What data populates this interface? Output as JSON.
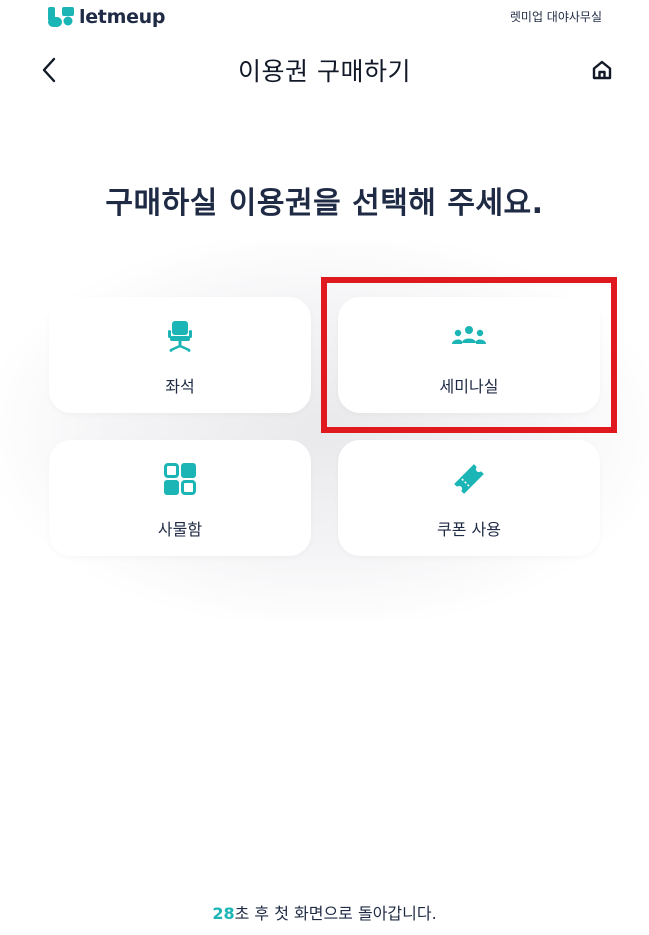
{
  "topbar": {
    "brand": "letmeup",
    "store_name": "렛미업 대야사무실"
  },
  "header": {
    "title": "이용권 구매하기",
    "back_icon": "chevron-left-icon",
    "home_icon": "home-icon"
  },
  "main": {
    "heading": "구매하실 이용권을 선택해 주세요.",
    "options": [
      {
        "label": "좌석",
        "icon": "chair-icon"
      },
      {
        "label": "세미나실",
        "icon": "group-icon"
      },
      {
        "label": "사물함",
        "icon": "locker-grid-icon"
      },
      {
        "label": "쿠폰 사용",
        "icon": "ticket-icon"
      }
    ]
  },
  "footer": {
    "countdown": "28",
    "message": "초 후 첫 화면으로 돌아갑니다."
  },
  "colors": {
    "accent": "#1bb5b5",
    "text": "#1f2a44",
    "highlight": "#e0191f"
  }
}
